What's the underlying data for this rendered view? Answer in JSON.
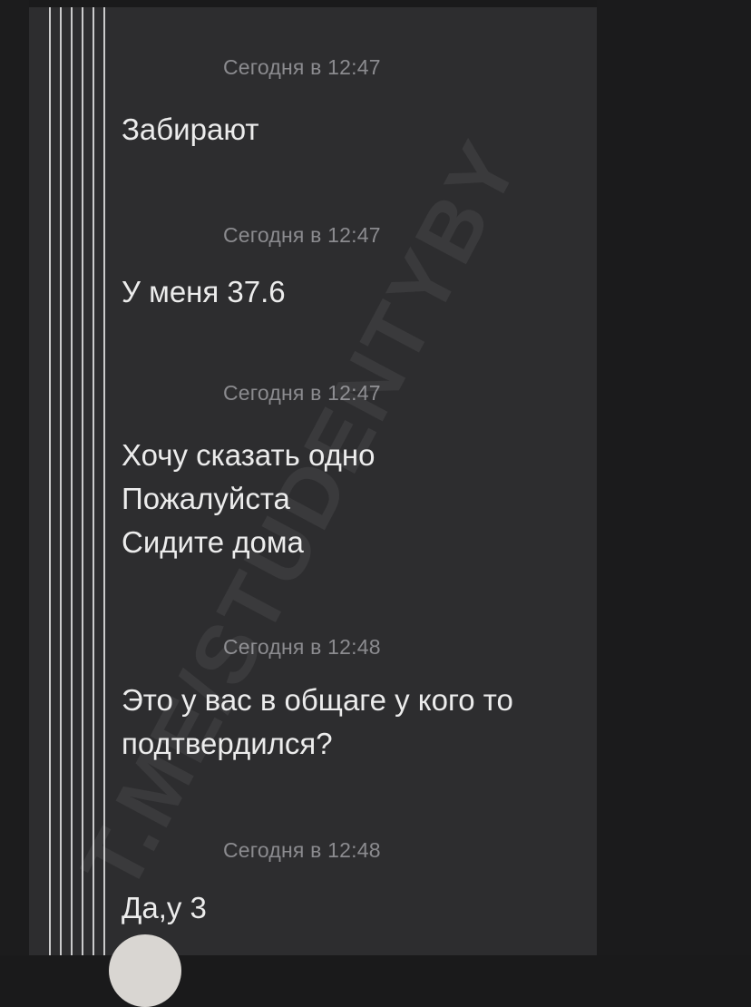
{
  "watermark": "T.ME/STUDENTYBY",
  "messages": [
    {
      "time": "Сегодня в 12:47",
      "text": "Забирают"
    },
    {
      "time": "Сегодня в 12:47",
      "text": "У меня 37.6"
    },
    {
      "time": "Сегодня в 12:47",
      "text": "Хочу сказать одно\nПожалуйста\nСидите дома"
    },
    {
      "time": "Сегодня в 12:48",
      "text": "Это у вас в общаге у кого то\nподтвердился?"
    },
    {
      "time": "Сегодня в 12:48",
      "text": "Да,у 3"
    }
  ],
  "colors": {
    "panel": "#2d2d2f",
    "background": "#1a1a1b",
    "text": "#ececec",
    "timestamp": "#8b8b8f"
  }
}
